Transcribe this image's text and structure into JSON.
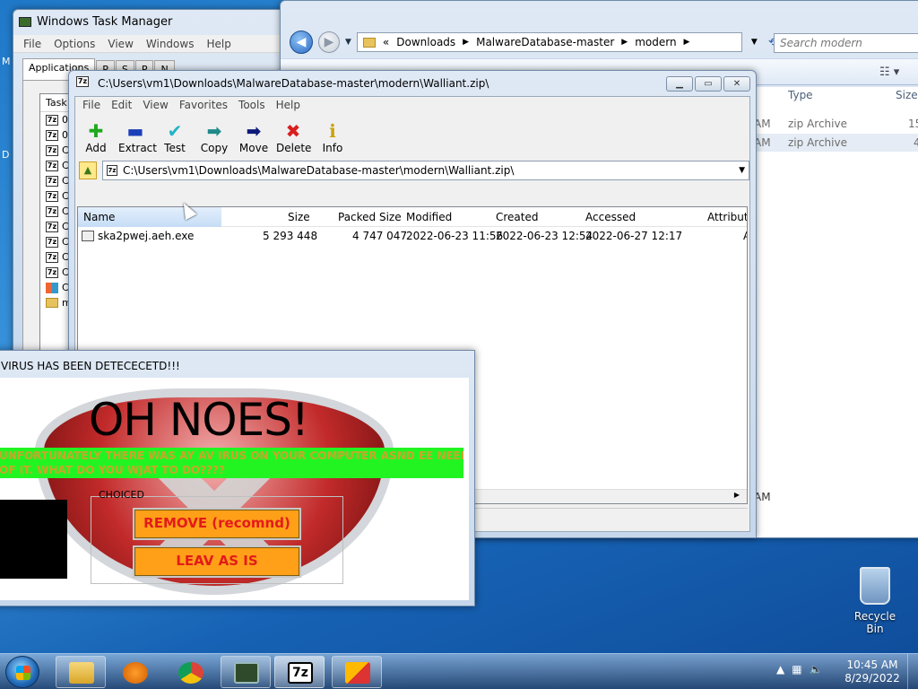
{
  "desktop": {
    "recycle_bin_label": "Recycle Bin",
    "side_text_m": "M",
    "side_text_d": "D"
  },
  "task_manager": {
    "title": "Windows Task Manager",
    "menu": [
      "File",
      "Options",
      "View",
      "Windows",
      "Help"
    ],
    "tabs": [
      "Applications",
      "P",
      "S",
      "P",
      "N"
    ],
    "column_header": "Task",
    "rows": [
      "0",
      "0",
      "C",
      "C",
      "C",
      "C",
      "C",
      "C",
      "C",
      "C",
      "C",
      "CA",
      "mo"
    ]
  },
  "explorer": {
    "breadcrumb": [
      "Downloads",
      "MalwareDatabase-master",
      "modern"
    ],
    "breadcrumb_prefix": "«",
    "search_placeholder": "Search modern",
    "columns": {
      "type": "Type",
      "size": "Size"
    },
    "rows": [
      {
        "time_frag": "AM",
        "type": "zip Archive",
        "size_frag": "15"
      },
      {
        "time_frag": "AM",
        "type": "zip Archive",
        "size_frag": "4"
      }
    ],
    "status_frag": "AM"
  },
  "zip": {
    "title": "C:\\Users\\vm1\\Downloads\\MalwareDatabase-master\\modern\\Walliant.zip\\",
    "menu": [
      "File",
      "Edit",
      "View",
      "Favorites",
      "Tools",
      "Help"
    ],
    "tools": [
      {
        "label": "Add",
        "glyph": "✚",
        "color": "#1ea81e"
      },
      {
        "label": "Extract",
        "glyph": "▬",
        "color": "#1a3fb8"
      },
      {
        "label": "Test",
        "glyph": "✔",
        "color": "#20b4c8"
      },
      {
        "label": "Copy",
        "glyph": "➡",
        "color": "#1f8a8a"
      },
      {
        "label": "Move",
        "glyph": "➡",
        "color": "#0d1a7a"
      },
      {
        "label": "Delete",
        "glyph": "✖",
        "color": "#d91e1e"
      },
      {
        "label": "Info",
        "glyph": "ℹ",
        "color": "#c9a10a"
      }
    ],
    "path": "C:\\Users\\vm1\\Downloads\\MalwareDatabase-master\\modern\\Walliant.zip\\",
    "columns": [
      "Name",
      "Size",
      "Packed Size",
      "Modified",
      "Created",
      "Accessed",
      "Attribute"
    ],
    "files": [
      {
        "name": "ska2pwej.aeh.exe",
        "size": "5 293 448",
        "packed": "4 747 047",
        "modified": "2022-06-23 11:56",
        "created": "2022-06-23 12:54",
        "accessed": "2022-06-27 12:17",
        "attr": "A"
      }
    ]
  },
  "malware_popup": {
    "title": "VIRUS HAS BEEN DETECECETD!!!",
    "headline": "OH NOES!",
    "banner_line1": "UNFORTUNATELY THERE WAS AY AV IRUS ON YOUR COMPUTER ASND EE NEED TO GERT RID",
    "banner_line2": "OF IT. WHAT DO YOU WJAT TO DO????",
    "group_label": "CHOICED",
    "remove_button": "REMOVE (recomnd)",
    "leave_button": "LEAV AS IS"
  },
  "taskbar": {
    "clock_time": "10:45 AM",
    "clock_date": "8/29/2022",
    "pinned": [
      "explorer",
      "media-player",
      "chrome",
      "task-manager",
      "7zip",
      "malware-app"
    ]
  }
}
